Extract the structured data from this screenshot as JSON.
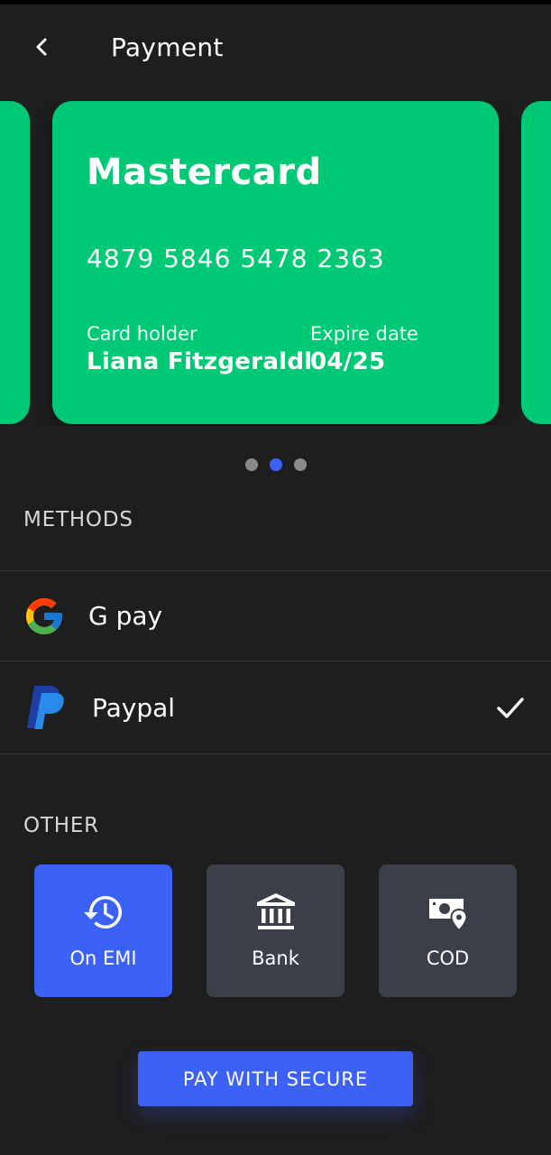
{
  "header": {
    "title": "Payment",
    "back_icon": "chevron-left-icon"
  },
  "card": {
    "brand": "Mastercard",
    "number": "4879 5846 5478 2363",
    "holder_label": "Card holder",
    "holder_name": "Liana Fitzgeraldl",
    "expire_label": "Expire date",
    "expire_value": "04/25",
    "color": "#00c975"
  },
  "carousel": {
    "total_cards": 3,
    "active_index": 1
  },
  "methods": {
    "title": "METHODS",
    "items": [
      {
        "label": "G pay",
        "icon": "google-icon",
        "selected": false
      },
      {
        "label": "Paypal",
        "icon": "paypal-icon",
        "selected": true
      }
    ]
  },
  "other": {
    "title": "OTHER",
    "tiles": [
      {
        "label": "On EMI",
        "icon": "history-icon",
        "active": true
      },
      {
        "label": "Bank",
        "icon": "bank-icon",
        "active": false
      },
      {
        "label": "COD",
        "icon": "cash-location-icon",
        "active": false
      }
    ]
  },
  "pay_button": {
    "label": "PAY WITH SECURE"
  },
  "colors": {
    "background": "#1e1e1f",
    "accent": "#3c61f6",
    "card_green": "#00c975",
    "tile_gray": "#3a3f4a"
  }
}
